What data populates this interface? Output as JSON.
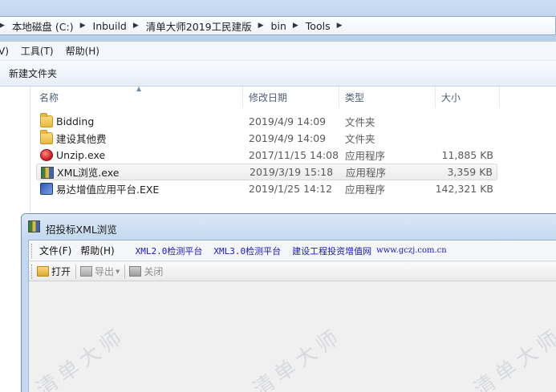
{
  "explorer": {
    "breadcrumbs": [
      "本地磁盘 (C:)",
      "Inbuild",
      "清单大师2019工民建版",
      "bin",
      "Tools"
    ],
    "menu": [
      "V)",
      "工具(T)",
      "帮助(H)"
    ],
    "command": {
      "new_folder": "新建文件夹"
    },
    "columns": {
      "name": "名称",
      "date": "修改日期",
      "type": "类型",
      "size": "大小"
    },
    "files": [
      {
        "icon": "folder-icon",
        "name": "Bidding",
        "date": "2019/4/9 14:09",
        "type": "文件夹",
        "size": ""
      },
      {
        "icon": "folder-icon",
        "name": "建设其他费",
        "date": "2019/4/9 14:09",
        "type": "文件夹",
        "size": ""
      },
      {
        "icon": "unzip-app-icon",
        "name": "Unzip.exe",
        "date": "2017/11/15 14:08",
        "type": "应用程序",
        "size": "11,885 KB"
      },
      {
        "icon": "xml-viewer-app-icon",
        "name": "XML浏览.exe",
        "date": "2019/3/19 15:18",
        "type": "应用程序",
        "size": "3,359 KB",
        "selected": true
      },
      {
        "icon": "exe-app-icon",
        "name": "易达增值应用平台.EXE",
        "date": "2019/1/25 14:12",
        "type": "应用程序",
        "size": "142,321 KB"
      }
    ]
  },
  "app": {
    "title": "招投标XML浏览",
    "menu": [
      "文件(F)",
      "帮助(H)"
    ],
    "links": [
      "XML2.0检测平台",
      "XML3.0检测平台",
      "建设工程投资增值网"
    ],
    "url": "www.gczj.com.cn",
    "toolbar": {
      "open": "打开",
      "export": "导出",
      "close": "关闭"
    },
    "watermark": "清单大师"
  }
}
